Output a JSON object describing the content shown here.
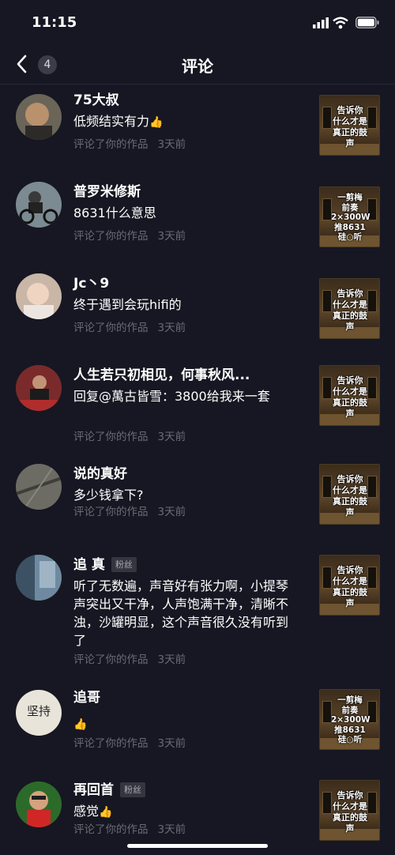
{
  "status_bar": {
    "time": "11:15"
  },
  "header": {
    "back_badge": "4",
    "title": "评论"
  },
  "comments": [
    {
      "name": "75大叔",
      "tag": "",
      "text": "低频结实有力",
      "emoji": "👍",
      "meta": "评论了你的作品",
      "time": "3天前",
      "thumb": "告诉你\n什么才是\n真正的鼓声"
    },
    {
      "name": "普罗米修斯",
      "tag": "",
      "text": "8631什么意思",
      "emoji": "",
      "meta": "评论了你的作品",
      "time": "3天前",
      "thumb": "一剪梅\n前奏\n2×300W\n推8631\n硅○听"
    },
    {
      "name": "Jc丶9",
      "tag": "",
      "text": "终于遇到会玩hifi的",
      "emoji": "",
      "meta": "评论了你的作品",
      "time": "3天前",
      "thumb": "告诉你\n什么才是\n真正的鼓声"
    },
    {
      "name": "人生若只初相见，何事秋风...",
      "tag": "",
      "text": "回复@萬古皆雪：3800给我来一套",
      "emoji": "",
      "meta": "评论了你的作品",
      "time": "3天前",
      "thumb": "告诉你\n什么才是\n真正的鼓声"
    },
    {
      "name": "说的真好",
      "tag": "",
      "text": "多少钱拿下?",
      "emoji": "",
      "meta": "评论了你的作品",
      "time": "3天前",
      "thumb": "告诉你\n什么才是\n真正的鼓声"
    },
    {
      "name": "追 真",
      "tag": "粉丝",
      "text": "听了无数遍，声音好有张力啊，小提琴声突出又干净，人声饱满干净，清晰不浊，沙罐明显，这个声音很久没有听到了",
      "emoji": "",
      "meta": "评论了你的作品",
      "time": "3天前",
      "thumb": "告诉你\n什么才是\n真正的鼓声"
    },
    {
      "name": "追哥",
      "tag": "",
      "text": "",
      "emoji": "👍",
      "meta": "评论了你的作品",
      "time": "3天前",
      "thumb": "一剪梅\n前奏\n2×300W\n推8631\n硅○听"
    },
    {
      "name": "再回首",
      "tag": "粉丝",
      "text": "感觉",
      "emoji": "👍",
      "meta": "评论了你的作品",
      "time": "3天前",
      "thumb": "告诉你\n什么才是\n真正的鼓声"
    }
  ],
  "avatar_texts": {
    "zhuige_avatar": "坚持"
  },
  "colors": {
    "background": "#161722",
    "secondary_text": "#6a6b75",
    "tag_bg": "#34353f"
  }
}
